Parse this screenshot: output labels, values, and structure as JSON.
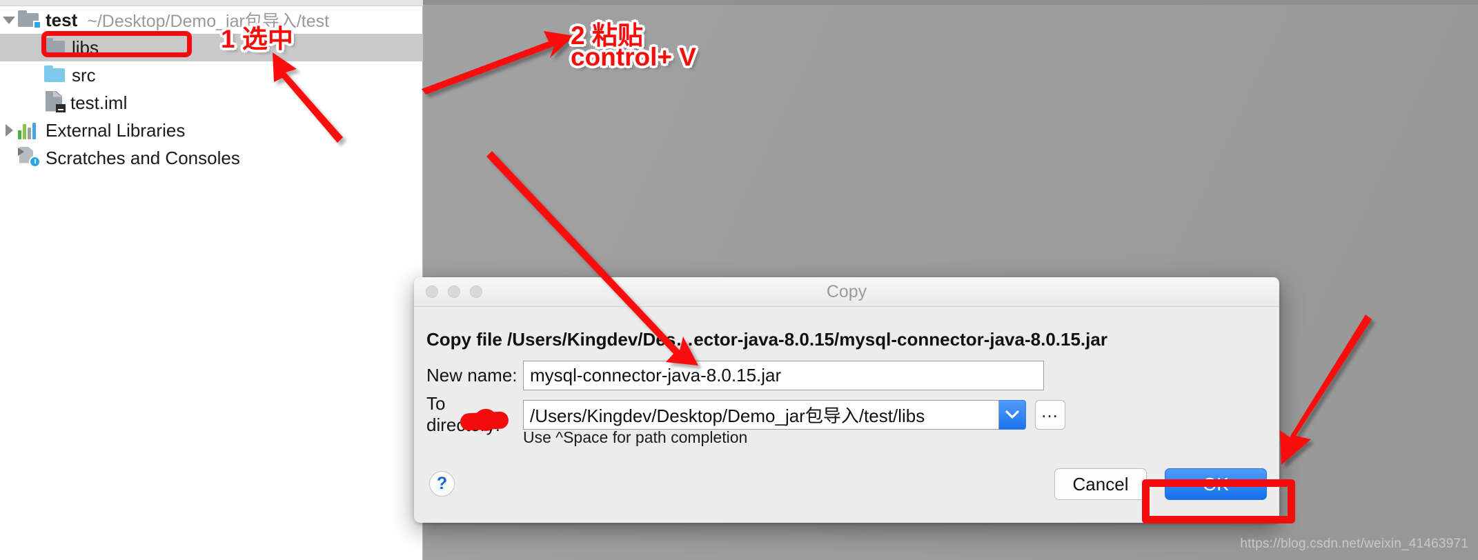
{
  "sidebar": {
    "tree": [
      {
        "label": "test",
        "path": "~/Desktop/Demo_jar包导入/test",
        "icon": "module-folder-icon",
        "twisty": "expanded",
        "indent": 0,
        "bold": true,
        "selected": false
      },
      {
        "label": "libs",
        "path": "",
        "icon": "folder-gray-icon",
        "twisty": "none",
        "indent": 1,
        "bold": false,
        "selected": true
      },
      {
        "label": "src",
        "path": "",
        "icon": "folder-blue-icon",
        "twisty": "none",
        "indent": 1,
        "bold": false,
        "selected": false
      },
      {
        "label": "test.iml",
        "path": "",
        "icon": "iml-file-icon",
        "twisty": "none",
        "indent": 1,
        "bold": false,
        "selected": false
      },
      {
        "label": "External Libraries",
        "path": "",
        "icon": "external-libraries-icon",
        "twisty": "collapsed",
        "indent": 0,
        "bold": false,
        "selected": false
      },
      {
        "label": "Scratches and Consoles",
        "path": "",
        "icon": "scratches-icon",
        "twisty": "none",
        "indent": 0,
        "bold": false,
        "selected": false
      }
    ]
  },
  "dialog": {
    "window_title": "Copy",
    "heading": "Copy file /Users/Kingdev/Des…ector-java-8.0.15/mysql-connector-java-8.0.15.jar",
    "new_name_label": "New name:",
    "new_name_value": "mysql-connector-java-8.0.15.jar",
    "to_directory_label": "To directory:",
    "to_directory_value": "/Users/Kingdev/Desktop/Demo_jar包导入/test/libs",
    "hint": "Use ^Space for path completion",
    "help_label": "?",
    "ellipsis_label": "…",
    "cancel_label": "Cancel",
    "ok_label": "OK",
    "traffic_lights": [
      "close-button",
      "minimize-button",
      "zoom-button"
    ]
  },
  "annotations": {
    "step1": "1 选中",
    "step2_line1": "2 粘贴",
    "step2_line2": "control+ V"
  },
  "colors": {
    "annotation_red": "#fb0a0a",
    "accent_blue": "#1570ec",
    "selection_gray": "#c9c9c9",
    "backdrop_gray": "#9d9d9d"
  },
  "watermark": "https://blog.csdn.net/weixin_41463971"
}
